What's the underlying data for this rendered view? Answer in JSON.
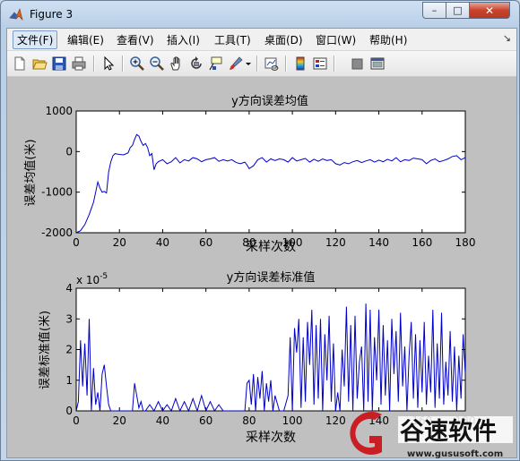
{
  "window": {
    "title": "Figure 3",
    "min_glyph": "–",
    "max_glyph": "□",
    "close_glyph": "✕"
  },
  "menu": {
    "items": [
      "文件(F)",
      "编辑(E)",
      "查看(V)",
      "插入(I)",
      "工具(T)",
      "桌面(D)",
      "窗口(W)",
      "帮助(H)"
    ],
    "dock_glyph": "↘"
  },
  "toolbar": {
    "icons": [
      "new-figure-icon",
      "open-file-icon",
      "save-icon",
      "print-icon",
      "pointer-icon",
      "zoom-in-icon",
      "zoom-out-icon",
      "pan-hand-icon",
      "rotate-3d-icon",
      "data-cursor-icon",
      "brush-icon",
      "link-plot-icon",
      "colorbar-icon",
      "legend-icon",
      "hide-plot-tools-icon",
      "show-plot-tools-icon"
    ]
  },
  "chart_data": [
    {
      "type": "line",
      "title": "y方向误差均值",
      "xlabel": "采样次数",
      "ylabel": "误差均值(米)",
      "xlim": [
        0,
        180
      ],
      "ylim": [
        -2000,
        1000
      ],
      "xticks": [
        "0",
        "20",
        "40",
        "60",
        "80",
        "100",
        "120",
        "140",
        "160",
        "180"
      ],
      "yticks": [
        "-2000",
        "-1000",
        "0",
        "1000"
      ],
      "color": "#0000c8",
      "series": [
        {
          "x": [
            0,
            2,
            4,
            6,
            7,
            8,
            9,
            10,
            11,
            12,
            13,
            14,
            15,
            16,
            17,
            18,
            19,
            20,
            22,
            24,
            25,
            26,
            27,
            28,
            29,
            30,
            31,
            32,
            33,
            34,
            35,
            36,
            37,
            38,
            40,
            42,
            44,
            46,
            48,
            50,
            52,
            54,
            56,
            58,
            60,
            62,
            64,
            66,
            68,
            70,
            72,
            74,
            76,
            78,
            79,
            80,
            82,
            84,
            86,
            88,
            90,
            92,
            94,
            96,
            98,
            100,
            102,
            104,
            106,
            108,
            110,
            112,
            114,
            116,
            118,
            120,
            122,
            124,
            126,
            128,
            130,
            132,
            134,
            136,
            138,
            140,
            142,
            144,
            146,
            148,
            150,
            152,
            154,
            156,
            158,
            160,
            162,
            164,
            166,
            168,
            170,
            172,
            174,
            176,
            178,
            180
          ],
          "y": [
            -2000,
            -1950,
            -1800,
            -1550,
            -1400,
            -1250,
            -1000,
            -750,
            -900,
            -1000,
            -980,
            -1020,
            -500,
            -250,
            -100,
            -50,
            -60,
            -70,
            -80,
            -30,
            100,
            150,
            300,
            420,
            380,
            250,
            150,
            200,
            100,
            -100,
            -50,
            -450,
            -300,
            -250,
            -200,
            -300,
            -250,
            -150,
            -280,
            -200,
            -230,
            -150,
            -180,
            -250,
            -200,
            -180,
            -150,
            -240,
            -200,
            -230,
            -200,
            -270,
            -300,
            -260,
            -330,
            -420,
            -350,
            -200,
            -150,
            -260,
            -180,
            -220,
            -180,
            -200,
            -260,
            -150,
            -230,
            -200,
            -170,
            -260,
            -190,
            -240,
            -180,
            -220,
            -200,
            -300,
            -330,
            -270,
            -300,
            -250,
            -220,
            -270,
            -230,
            -200,
            -260,
            -210,
            -250,
            -190,
            -230,
            -150,
            -250,
            -200,
            -220,
            -160,
            -180,
            -200,
            -300,
            -220,
            -180,
            -250,
            -220,
            -180,
            -120,
            -100,
            -200,
            -150
          ]
        }
      ]
    },
    {
      "type": "line",
      "title": "y方向误差标准值",
      "xlabel": "采样次数",
      "ylabel": "误差标准值(米)",
      "y_scale_note": "x 10",
      "y_scale_exp": "-5",
      "xlim": [
        0,
        180
      ],
      "ylim": [
        0,
        4
      ],
      "xticks": [
        "0",
        "20",
        "40",
        "60",
        "80",
        "100",
        "120",
        "140",
        "160",
        "180"
      ],
      "yticks": [
        "0",
        "1",
        "2",
        "3",
        "4"
      ],
      "color": "#0000c8",
      "series": [
        {
          "x": [
            0,
            1,
            2,
            3,
            4,
            5,
            6,
            7,
            8,
            9,
            10,
            11,
            12,
            13,
            14,
            15,
            16,
            17,
            18,
            20,
            22,
            24,
            26,
            27,
            28,
            29,
            30,
            31,
            32,
            34,
            36,
            38,
            40,
            42,
            44,
            46,
            48,
            50,
            52,
            54,
            56,
            58,
            60,
            62,
            64,
            66,
            68,
            70,
            72,
            74,
            76,
            78,
            79,
            80,
            81,
            82,
            83,
            84,
            85,
            86,
            87,
            88,
            89,
            90,
            91,
            92,
            94,
            96,
            98,
            99,
            100,
            101,
            102,
            103,
            104,
            105,
            106,
            107,
            108,
            109,
            110,
            111,
            112,
            113,
            114,
            115,
            116,
            117,
            118,
            119,
            120,
            121,
            122,
            123,
            124,
            125,
            126,
            127,
            128,
            129,
            130,
            131,
            132,
            133,
            134,
            135,
            136,
            137,
            138,
            139,
            140,
            141,
            142,
            143,
            144,
            145,
            146,
            147,
            148,
            149,
            150,
            151,
            152,
            153,
            154,
            155,
            156,
            157,
            158,
            159,
            160,
            161,
            162,
            163,
            164,
            165,
            166,
            167,
            168,
            169,
            170,
            171,
            172,
            173,
            174,
            175,
            176,
            177,
            178,
            179,
            180
          ],
          "y": [
            0,
            0.3,
            2.3,
            0.8,
            2.2,
            0.5,
            3.0,
            0,
            1.4,
            0.2,
            0.6,
            0,
            1.2,
            1.5,
            0.8,
            0.2,
            0,
            0,
            0,
            0,
            0,
            0,
            0,
            0.9,
            0.5,
            0.1,
            0.3,
            0,
            0,
            0.2,
            0,
            0.3,
            0,
            0.2,
            0,
            0.4,
            0,
            0.3,
            0,
            0.4,
            0,
            0.5,
            0,
            0.3,
            0,
            0.2,
            0,
            0,
            0,
            0,
            0,
            0,
            0.9,
            1.0,
            0.2,
            1.2,
            0,
            1.1,
            0.4,
            1.3,
            0,
            0.9,
            0.3,
            1.0,
            0,
            0.5,
            0,
            0,
            0.5,
            2.4,
            0,
            2.7,
            1.9,
            3.0,
            0.1,
            2.4,
            0.3,
            2.9,
            1.5,
            3.3,
            0.2,
            2.8,
            0.4,
            3.0,
            0,
            2.5,
            1.0,
            3.1,
            0.3,
            2.2,
            0,
            0.6,
            0,
            2.0,
            0.8,
            3.4,
            0.3,
            2.8,
            0,
            3.1,
            0.4,
            1.6,
            2.1,
            0,
            3.5,
            0.3,
            3.3,
            0,
            2.4,
            1.0,
            3.3,
            0.2,
            2.8,
            0.5,
            2.3,
            0,
            3.0,
            1.2,
            2.6,
            0.3,
            3.2,
            0.8,
            2.1,
            0,
            1.8,
            2.9,
            0.4,
            2.5,
            0.1,
            2.3,
            0.6,
            2.9,
            0.2,
            1.8,
            0.6,
            3.3,
            0.1,
            2.2,
            0.4,
            3.2,
            0.2,
            1.6,
            0.5,
            2.6,
            0.3,
            2.1,
            0,
            1.8,
            0.4,
            2.5,
            1.2
          ]
        }
      ]
    }
  ],
  "watermark": {
    "brand": "谷速软件",
    "url": "www.gususoft.com"
  }
}
